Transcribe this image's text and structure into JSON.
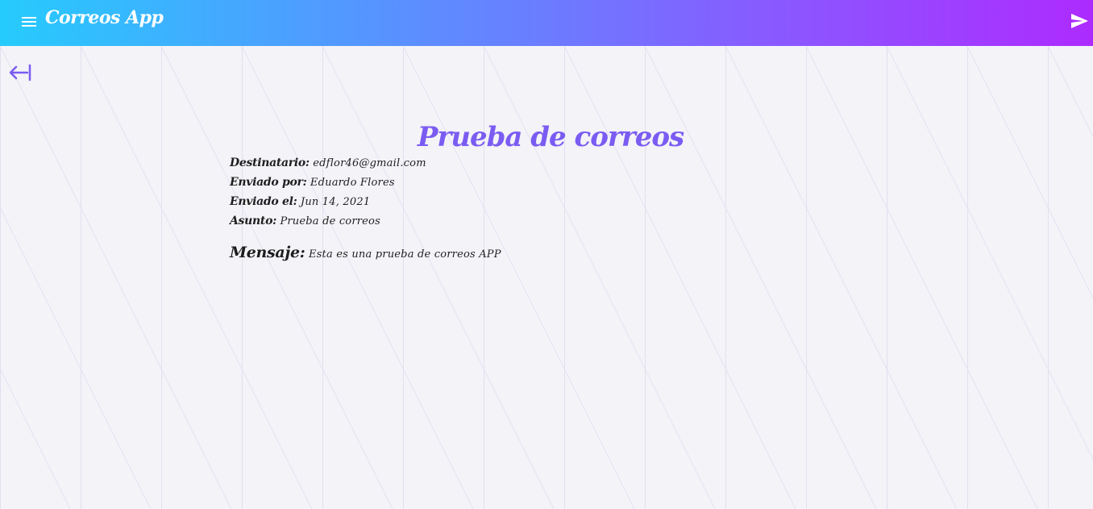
{
  "header": {
    "app_title": "Correos App",
    "menu_icon": "menu-icon",
    "send_icon": "send-icon",
    "gradient_start": "#26cbfd",
    "gradient_end": "#ad2bff"
  },
  "navigation": {
    "back_icon": "back-arrow-icon"
  },
  "mail": {
    "subject_title": "Prueba de correos",
    "fields": [
      {
        "label": "Destinatario:",
        "value": "edflor46@gmail.com"
      },
      {
        "label": "Enviado por:",
        "value": "Eduardo Flores"
      },
      {
        "label": "Enviado el:",
        "value": "Jun 14, 2021"
      },
      {
        "label": "Asunto:",
        "value": "Prueba de correos"
      }
    ],
    "message": {
      "label": "Mensaje:",
      "value": "Esta es una prueba de correos APP"
    }
  },
  "colors": {
    "accent": "#7b5cf2",
    "background": "#f4f3f8",
    "text": "#1e1e1e",
    "pattern_line": "#dcdbef"
  }
}
